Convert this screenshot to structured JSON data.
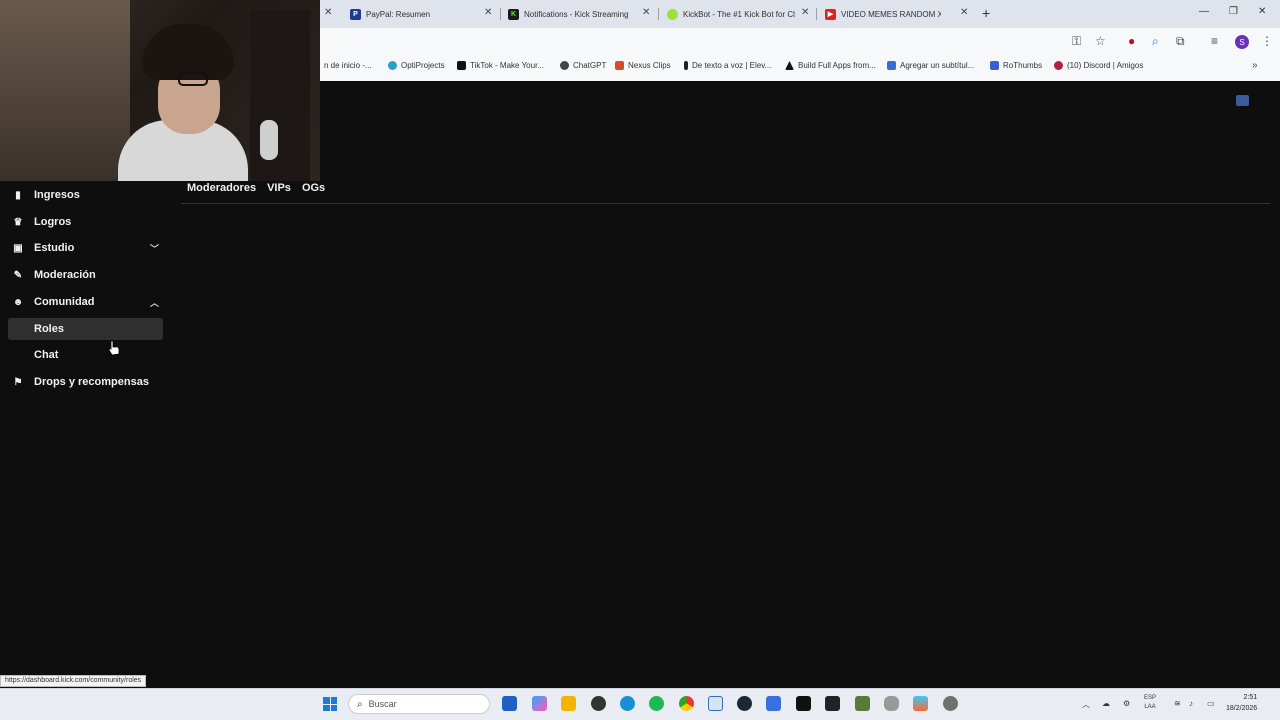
{
  "browser": {
    "tabs": [
      {
        "title": "PayPal: Resumen",
        "fav_color": "#1f3b8c",
        "fav_glyph": "P"
      },
      {
        "title": "Notifications - Kick Streaming",
        "fav_color": "#1a1a1a",
        "fav_glyph": "K"
      },
      {
        "title": "KickBot - The #1 Kick Bot for Cl",
        "fav_color": "#9be33b",
        "fav_glyph": ""
      },
      {
        "title": "VIDEO MEMES RANDOM X",
        "fav_color": "#e02020",
        "fav_glyph": "▶"
      }
    ],
    "new_tab_label": "+",
    "bookmarks": [
      {
        "label": "n de inicio -...",
        "color": "#f7f8fa"
      },
      {
        "label": "OptiProjects",
        "color": "#2aa0c8"
      },
      {
        "label": "TikTok - Make Your...",
        "color": "#111111"
      },
      {
        "label": "ChatGPT",
        "color": "#444444"
      },
      {
        "label": "Nexus Clips",
        "color": "#d84a2a"
      },
      {
        "label": "De texto a voz | Elev...",
        "color": "#222222"
      },
      {
        "label": "Build Full Apps from...",
        "color": "#111111"
      },
      {
        "label": "Agregar un subtítul...",
        "color": "#3b6bd6"
      },
      {
        "label": "RoThumbs",
        "color": "#3a5fcf"
      },
      {
        "label": "(10) Discord | Amigos",
        "color": "#b02040"
      }
    ],
    "profile_letter": "S"
  },
  "sidebar": {
    "items": [
      {
        "label": "Ingresos",
        "icon": "chart-icon",
        "glyph": "▮"
      },
      {
        "label": "Logros",
        "icon": "trophy-icon",
        "glyph": "♛"
      },
      {
        "label": "Estudio",
        "icon": "studio-icon",
        "glyph": "▣",
        "chevron": "down"
      },
      {
        "label": "Moderación",
        "icon": "wrench-icon",
        "glyph": "✎"
      },
      {
        "label": "Comunidad",
        "icon": "community-icon",
        "glyph": "☻",
        "chevron": "up"
      }
    ],
    "sub_items": [
      {
        "label": "Roles",
        "active": true
      },
      {
        "label": "Chat",
        "active": false
      }
    ],
    "bottom_item": {
      "label": "Drops y recompensas",
      "icon": "gift-icon",
      "glyph": "⚑"
    }
  },
  "main": {
    "tabs": [
      "Moderadores",
      "VIPs",
      "OGs"
    ]
  },
  "status_url": "https://dashboard.kick.com/community/roles",
  "taskbar": {
    "search_placeholder": "Buscar",
    "lang_top": "ESP",
    "lang_bottom": "LAA",
    "time": "2:51",
    "date": "18/2/2026"
  }
}
